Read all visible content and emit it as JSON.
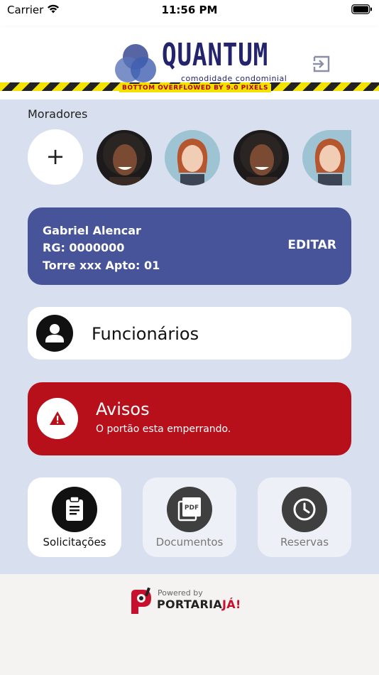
{
  "status_bar": {
    "carrier": "Carrier",
    "time": "11:56 PM"
  },
  "header": {
    "logo_name": "QUANTUM",
    "logo_tagline": "comodidade condominial",
    "overflow_warning": "BOTTOM OVERFLOWED BY 9.0 PIXELS"
  },
  "residents": {
    "label": "Moradores",
    "add_label": "+",
    "avatars": [
      "avatar-woman-curly-hair",
      "avatar-woman-red-hair",
      "avatar-woman-curly-hair",
      "avatar-woman-red-hair"
    ]
  },
  "user_card": {
    "name": "Gabriel Alencar",
    "rg": "RG: 0000000",
    "address": "Torre xxx  Apto: 01",
    "edit_label": "EDITAR"
  },
  "staff": {
    "label": "Funcionários"
  },
  "notice": {
    "title": "Avisos",
    "message": "O portão esta emperrando."
  },
  "actions": [
    {
      "label": "Solicitações",
      "icon": "clipboard-icon",
      "active": true
    },
    {
      "label": "Documentos",
      "icon": "pdf-icon",
      "active": false
    },
    {
      "label": "Reservas",
      "icon": "clock-icon",
      "active": false
    }
  ],
  "footer": {
    "powered_by": "Powered by",
    "brand": "PORTARIA",
    "brand_suffix": "JÁ!"
  },
  "colors": {
    "background": "#d8dfee",
    "user_card": "#47549a",
    "notice": "#b8101a",
    "logo": "#23246b",
    "brand_accent": "#c8102e"
  }
}
